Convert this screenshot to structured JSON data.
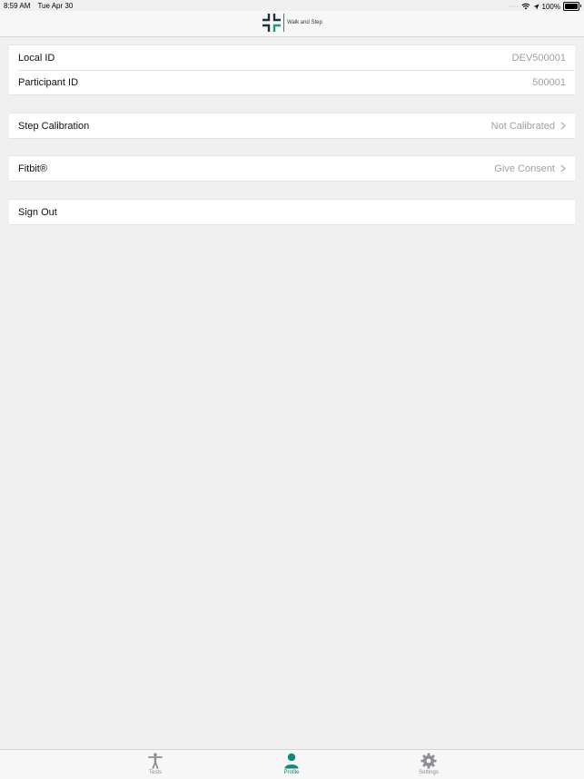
{
  "status_bar": {
    "time": "8:59 AM",
    "date": "Tue Apr 30",
    "battery": "100%",
    "icons": [
      "cellular-signal-icon",
      "wifi-icon",
      "location-arrow-icon",
      "battery-icon"
    ]
  },
  "nav_bar": {
    "logo_text": "Walk and Step"
  },
  "identity_group": {
    "rows": [
      {
        "label": "Local ID",
        "value": "DEV500001"
      },
      {
        "label": "Participant ID",
        "value": "500001"
      }
    ]
  },
  "calibration_group": {
    "label": "Step Calibration",
    "value": "Not Calibrated"
  },
  "fitbit_group": {
    "label": "Fitbit®",
    "value": "Give Consent"
  },
  "signout_group": {
    "label": "Sign Out"
  },
  "tab_bar": {
    "tabs": [
      {
        "label": "Tests",
        "icon": "person-figure-icon",
        "active": false
      },
      {
        "label": "Profile",
        "icon": "profile-icon",
        "active": true
      },
      {
        "label": "Settings",
        "icon": "gear-icon",
        "active": false
      }
    ]
  },
  "colors": {
    "accent": "#0b8a7d",
    "inactive_tab": "#8e8e93",
    "secondary_text": "#a0a0a0",
    "background": "#f0f0f0"
  }
}
